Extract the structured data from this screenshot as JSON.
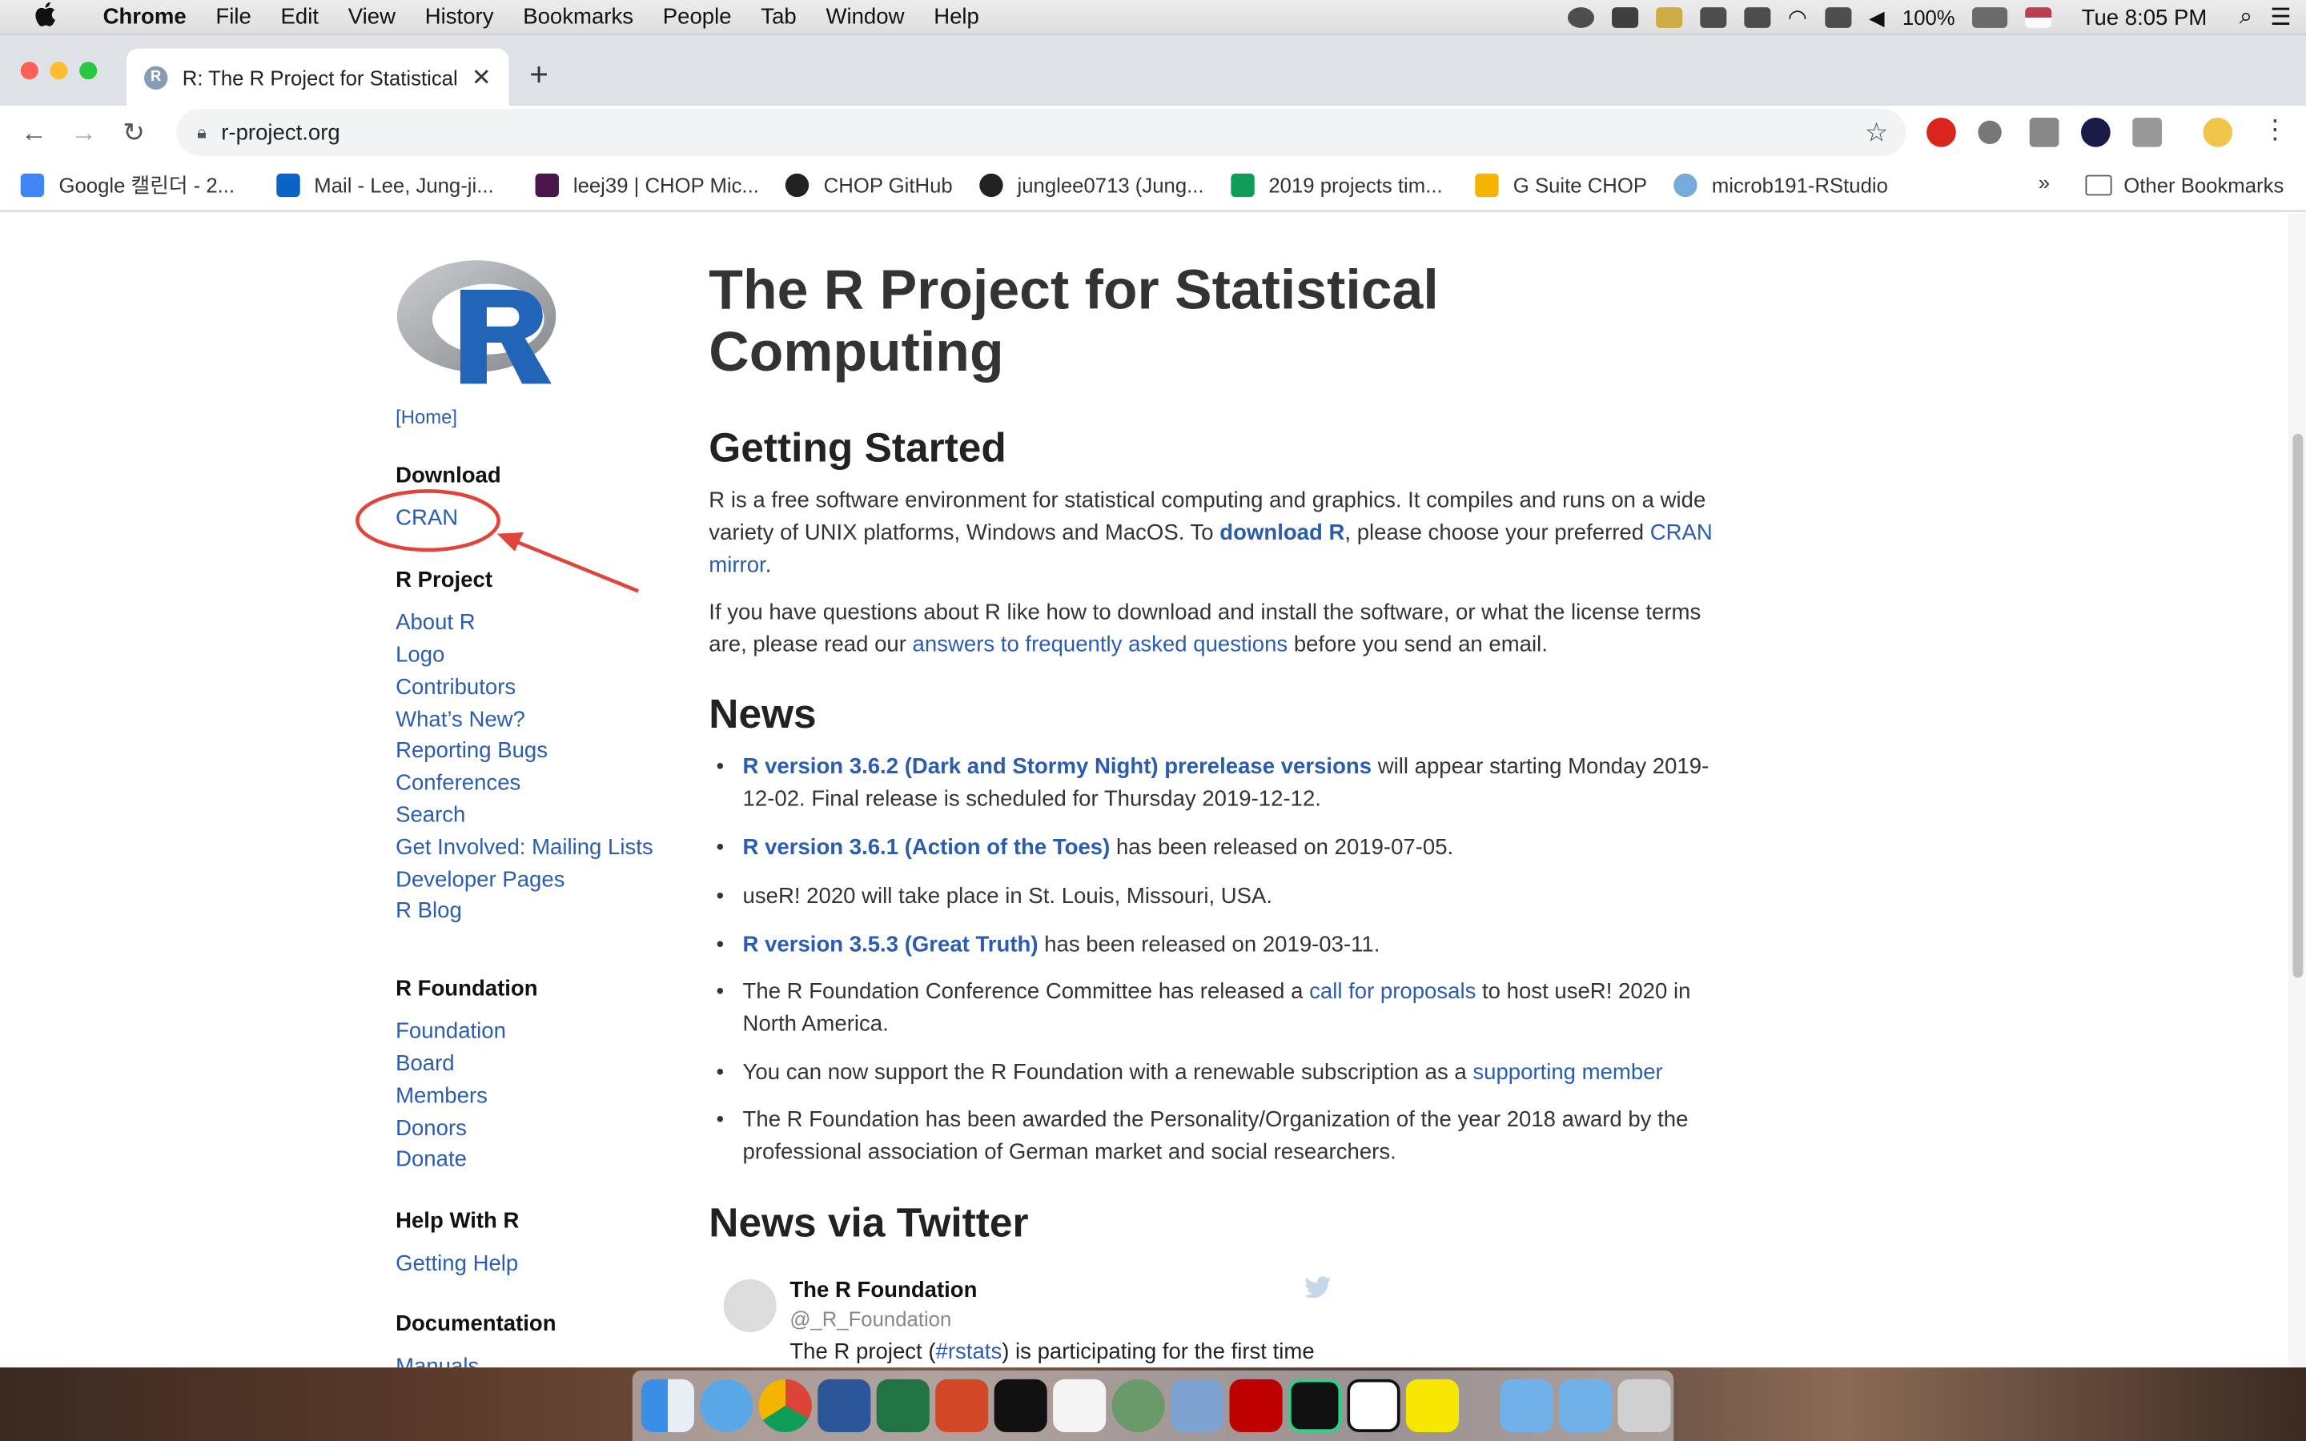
{
  "menubar": {
    "apple": "",
    "app_name": "Chrome",
    "items": [
      "File",
      "Edit",
      "View",
      "History",
      "Bookmarks",
      "People",
      "Tab",
      "Window",
      "Help"
    ],
    "battery": "100%",
    "clock": "Tue 8:05 PM"
  },
  "tab": {
    "title": "R: The R Project for Statistical C",
    "close": "✕",
    "new_tab": "+"
  },
  "toolbar": {
    "back": "←",
    "forward": "→",
    "reload": "↻",
    "url": "r-project.org"
  },
  "bookmarks": {
    "items": [
      {
        "label": "Google 캘린더 - 2...",
        "color": "#4285f4"
      },
      {
        "label": "Mail - Lee, Jung-ji...",
        "color": "#0a64c8"
      },
      {
        "label": "leej39 | CHOP Mic...",
        "color": "#4a154b"
      },
      {
        "label": "CHOP GitHub",
        "color": "#222222"
      },
      {
        "label": "junglee0713 (Jung...",
        "color": "#222222"
      },
      {
        "label": "2019 projects tim...",
        "color": "#0f9d58"
      },
      {
        "label": "G Suite CHOP",
        "color": "#f4b400"
      },
      {
        "label": "microb191-RStudio",
        "color": "#75aadb"
      }
    ],
    "more": "»",
    "other": "Other Bookmarks"
  },
  "sidebar": {
    "home": "[Home]",
    "download_head": "Download",
    "cran": "CRAN",
    "rproject_head": "R Project",
    "rproject_links": [
      "About R",
      "Logo",
      "Contributors",
      "What’s New?",
      "Reporting Bugs",
      "Conferences",
      "Search",
      "Get Involved: Mailing Lists",
      "Developer Pages",
      "R Blog"
    ],
    "foundation_head": "R Foundation",
    "foundation_links": [
      "Foundation",
      "Board",
      "Members",
      "Donors",
      "Donate"
    ],
    "help_head": "Help With R",
    "help_links": [
      "Getting Help"
    ],
    "doc_head": "Documentation",
    "doc_links": [
      "Manuals"
    ]
  },
  "main": {
    "title": "The R Project for Statistical Computing",
    "getting_started": "Getting Started",
    "p1_a": "R is a free software environment for statistical computing and graphics. It compiles and runs on a wide variety of UNIX platforms, Windows and MacOS. To ",
    "p1_link1": "download R",
    "p1_b": ", please choose your preferred ",
    "p1_link2": "CRAN mirror",
    "p1_c": ".",
    "p2_a": "If you have questions about R like how to download and install the software, or what the license terms are, please read our ",
    "p2_link": "answers to frequently asked questions",
    "p2_b": " before you send an email.",
    "news_head": "News",
    "news": [
      {
        "link": "R version 3.6.2 (Dark and Stormy Night) prerelease versions",
        "text": " will appear starting Monday 2019-12-02. Final release is scheduled for Thursday 2019-12-12."
      },
      {
        "link": "R version 3.6.1 (Action of the Toes)",
        "text": " has been released on 2019-07-05."
      },
      {
        "link": "",
        "text": "useR! 2020 will take place in St. Louis, Missouri, USA."
      },
      {
        "link": "R version 3.5.3 (Great Truth)",
        "text": " has been released on 2019-03-11."
      },
      {
        "pre": "The R Foundation Conference Committee has released a ",
        "link2": "call for proposals",
        "text": " to host useR! 2020 in North America."
      },
      {
        "pre": "You can now support the R Foundation with a renewable subscription as a ",
        "link2": "supporting member",
        "text": ""
      },
      {
        "pre": "The R Foundation has been awarded the Personality/Organization of the year 2018 award by the professional association of German market and social researchers.",
        "link2": "",
        "text": ""
      }
    ],
    "twitter_head": "News via Twitter",
    "tweet": {
      "name": "The R Foundation",
      "handle": "@_R_Foundation",
      "text_a": "The R project (",
      "hashtag": "#rstats",
      "text_b": ") is participating for the first time"
    }
  },
  "colors": {
    "link": "#2a5db0",
    "annotation": "#e0443a"
  }
}
